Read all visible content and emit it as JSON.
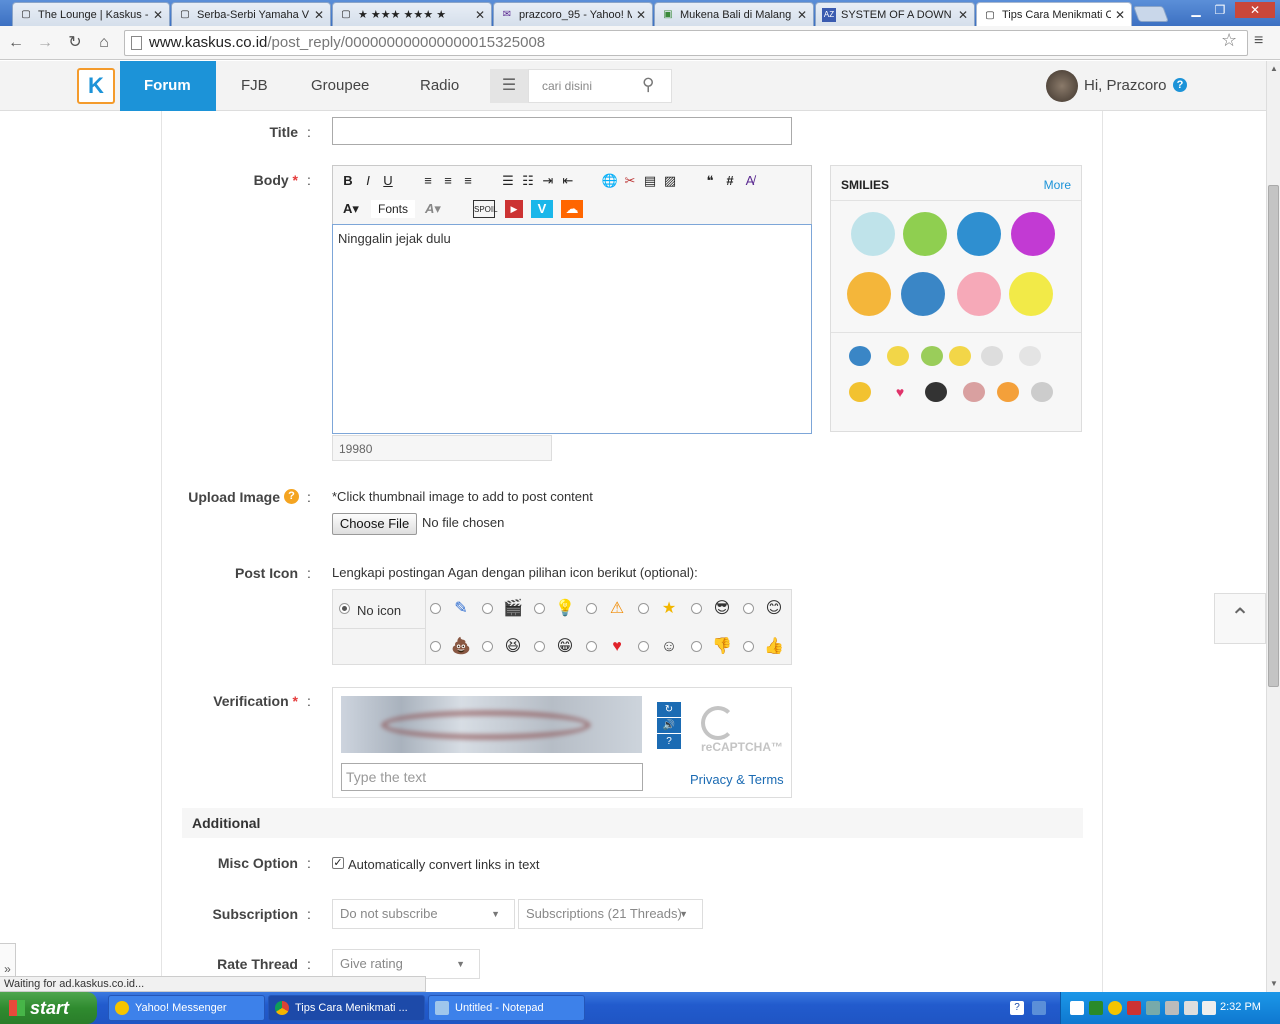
{
  "browser": {
    "tabs": [
      {
        "label": "The Lounge | Kaskus -",
        "icon": "page-icon"
      },
      {
        "label": "Serba-Serbi Yamaha V",
        "icon": "page-icon"
      },
      {
        "label": "★ ★★★ ★★★ ★",
        "icon": "page-icon"
      },
      {
        "label": "prazcoro_95 - Yahoo! M",
        "icon": "mail-icon"
      },
      {
        "label": "Mukena Bali di Malang",
        "icon": "page-icon"
      },
      {
        "label": "SYSTEM OF A DOWN L",
        "icon": "az-icon"
      },
      {
        "label": "Tips Cara Menikmati O",
        "icon": "page-icon"
      }
    ],
    "url_host": "www.kaskus.co.id",
    "url_path": "/post_reply/000000000000000015325008"
  },
  "kaskus_nav": {
    "logo": "K",
    "items": [
      "Forum",
      "FJB",
      "Groupee",
      "Radio"
    ],
    "search_placeholder": "cari disini",
    "greeting": "Hi, Prazcoro",
    "help": "?"
  },
  "form": {
    "title_label": "Title",
    "title_value": "",
    "body_label": "Body",
    "required_mark": "*",
    "colon": ":",
    "body_text": "Ninggalin jejak dulu",
    "char_counter": "19980",
    "fonts_label": "Fonts",
    "upload_label": "Upload Image",
    "upload_note": "*Click thumbnail image to add to post content",
    "choose_file": "Choose File",
    "no_file": "No file chosen",
    "post_icon_label": "Post Icon",
    "post_icon_note": "Lengkapi postingan Agan dengan pilihan icon berikut (optional):",
    "no_icon": "No icon",
    "verification_label": "Verification",
    "captcha_placeholder": "Type the text",
    "recaptcha": "reCAPTCHA™",
    "privacy_terms": "Privacy & Terms",
    "additional": "Additional",
    "misc_label": "Misc Option",
    "misc_option": "Automatically convert links in text",
    "subscription_label": "Subscription",
    "subscription_value": "Do not subscribe",
    "subscriptions_folder": "Subscriptions (21 Threads)",
    "rate_label": "Rate Thread",
    "rate_value": "Give rating"
  },
  "smilies": {
    "title": "SMILIES",
    "more": "More"
  },
  "status_bar": "Waiting for ad.kaskus.co.id...",
  "taskbar": {
    "start": "start",
    "items": [
      "Yahoo! Messenger",
      "Tips Cara Menikmati ...",
      "Untitled - Notepad"
    ],
    "clock": "2:32 PM"
  }
}
